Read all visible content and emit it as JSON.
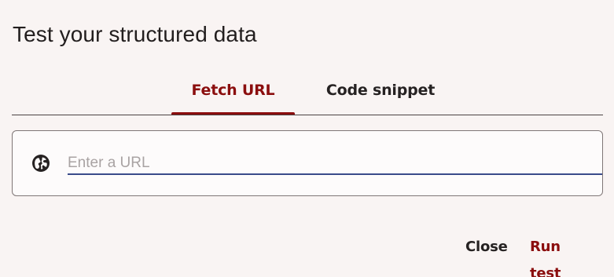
{
  "dialog": {
    "title": "Test your structured data"
  },
  "tabs": [
    {
      "label": "Fetch URL",
      "selected": true
    },
    {
      "label": "Code snippet",
      "selected": false
    }
  ],
  "url_field": {
    "icon": "globe-icon",
    "value": "",
    "placeholder": "Enter a URL"
  },
  "actions": {
    "close_label": "Close",
    "run_label": "Run test"
  },
  "colors": {
    "accent": "#8b0e0e",
    "background": "#f9f4f3",
    "input_underline": "#3a4a8a"
  }
}
